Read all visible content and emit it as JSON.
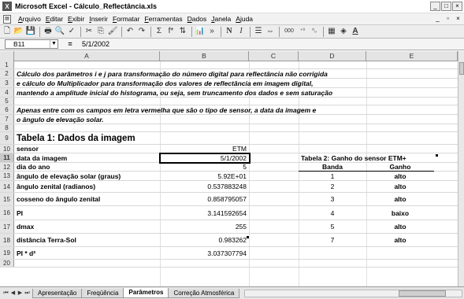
{
  "window": {
    "title": "Microsoft Excel - Cálculo_Reflectância.xls",
    "app_icon": "excel-icon",
    "controls": [
      "_",
      "□",
      "×"
    ]
  },
  "menu": {
    "items": [
      "Arquivo",
      "Editar",
      "Exibir",
      "Inserir",
      "Formatar",
      "Ferramentas",
      "Dados",
      "Janela",
      "Ajuda"
    ],
    "mdi_controls": [
      "_",
      "▫",
      "×"
    ]
  },
  "toolbar": {
    "font_size": "%",
    "bold_label": "N",
    "italic_label": "I",
    "currency_label": "000",
    "percent_label": "%",
    "sum_label": "Σ",
    "function_label": "f*"
  },
  "formula_bar": {
    "cell_ref": "B11",
    "equals": "=",
    "content": "5/1/2002"
  },
  "columns": [
    "A",
    "B",
    "C",
    "D",
    "E"
  ],
  "rows": [
    {
      "num": "1",
      "cells": {}
    },
    {
      "num": "2",
      "cells": {
        "a": "Cálculo dos parâmetros i e j para transformação do número digital para reflectância não corrigida"
      }
    },
    {
      "num": "3",
      "cells": {
        "a": "e cálculo do Multiplicador para transformação dos valores de reflectância em imagem digital,"
      }
    },
    {
      "num": "4",
      "cells": {
        "a": "mantendo a amplitude inicial do histograma, ou seja,  sem truncamento dos dados e sem saturação"
      }
    },
    {
      "num": "5",
      "cells": {}
    },
    {
      "num": "6",
      "cells": {
        "a": "Apenas entre com os campos em letra vermelha que são o tipo de sensor, a data da imagem e"
      }
    },
    {
      "num": "7",
      "cells": {
        "a": "o ângulo de elevação solar."
      }
    },
    {
      "num": "8",
      "cells": {}
    },
    {
      "num": "9",
      "cells": {
        "a": "Tabela 1: Dados da imagem"
      }
    },
    {
      "num": "10",
      "cells": {
        "a": "sensor",
        "b": "ETM"
      }
    },
    {
      "num": "11",
      "cells": {
        "a": "data da imagem",
        "b": "5/1/2002",
        "d": "Tabela 2: Ganho do sensor ETM+"
      }
    },
    {
      "num": "12",
      "cells": {
        "a": "dia do ano",
        "b": "5",
        "d": "Banda",
        "e": "Ganho"
      }
    },
    {
      "num": "13",
      "cells": {
        "a": "ângulo de elevação solar (graus)",
        "b": "5.92E+01",
        "d": "1",
        "e": "alto"
      }
    },
    {
      "num": "14",
      "cells": {
        "a": "ângulo zenital (radianos)",
        "b": "0.537883248",
        "d": "2",
        "e": "alto"
      }
    },
    {
      "num": "15",
      "cells": {
        "a": "cosseno do ângulo zenital",
        "b": "0.858795057",
        "d": "3",
        "e": "alto"
      }
    },
    {
      "num": "16",
      "cells": {
        "a": "PI",
        "b": "3.141592654",
        "d": "4",
        "e": "baixo"
      }
    },
    {
      "num": "17",
      "cells": {
        "a": "dmax",
        "b": "255",
        "d": "5",
        "e": "alto"
      }
    },
    {
      "num": "18",
      "cells": {
        "a": "distância Terra-Sol",
        "b": "0.983262",
        "d": "7",
        "e": "alto"
      }
    },
    {
      "num": "19",
      "cells": {
        "a": "PI * d²",
        "b": "3.037307794"
      }
    },
    {
      "num": "20",
      "cells": {}
    }
  ],
  "sheet_tabs": [
    "Apresentação",
    "Freqüência",
    "Parâmetros",
    "Correção Atmosférica"
  ],
  "active_tab": "Parâmetros"
}
